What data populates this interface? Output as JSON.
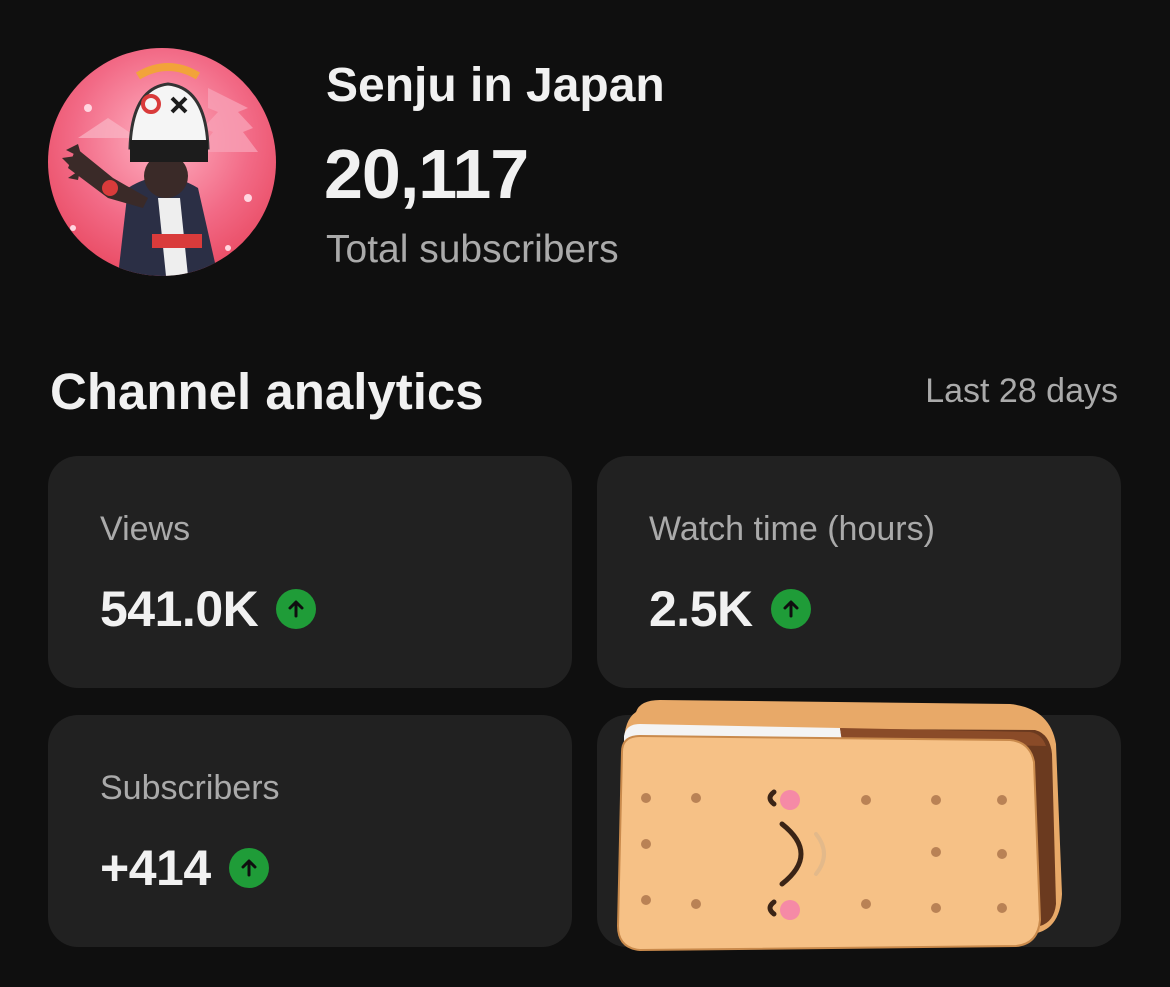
{
  "channel": {
    "name": "Senju in Japan",
    "subscriber_count": "20,117",
    "subscriber_label": "Total subscribers"
  },
  "analytics": {
    "title": "Channel analytics",
    "period": "Last 28 days",
    "cards": [
      {
        "label": "Views",
        "value": "541.0K",
        "trend": "up",
        "trend_icon": "arrow-up-icon"
      },
      {
        "label": "Watch time (hours)",
        "value": "2.5K",
        "trend": "up",
        "trend_icon": "arrow-up-icon"
      },
      {
        "label": "Subscribers",
        "value": "+414",
        "trend": "up",
        "trend_icon": "arrow-up-icon"
      }
    ]
  },
  "colors": {
    "background": "#0f0f0f",
    "card": "#212121",
    "primary_text": "#f1f1f1",
    "secondary_text": "#aaaaaa",
    "trend_up": "#1f9c38"
  }
}
